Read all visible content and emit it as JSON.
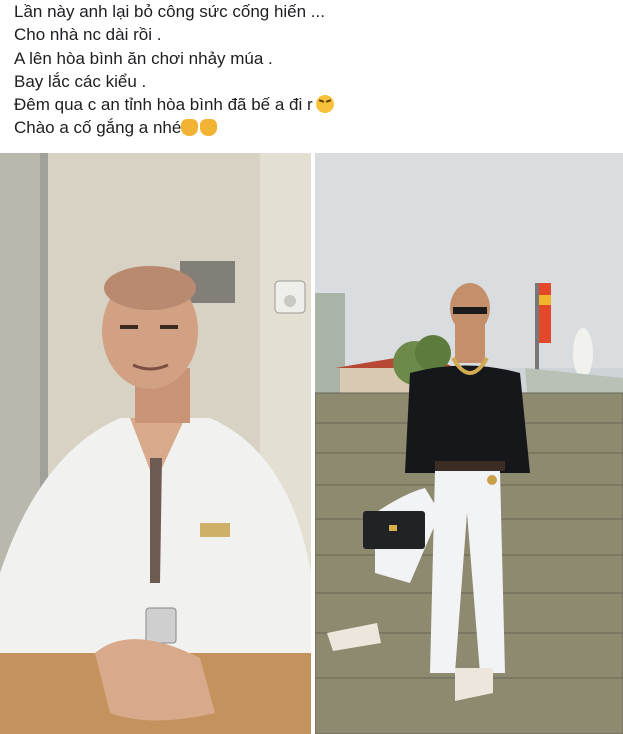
{
  "post": {
    "lines": [
      "Lần này anh lại bỏ công sức cống hiến ...",
      "Cho nhà nc dài rồi .",
      "A lên hòa bình ăn chơi nhảy múa .",
      "Bay lắc các kiểu .",
      "Đêm qua c an tỉnh hòa bình đã bế a đi r",
      "Chào a cố gắng a nhé"
    ],
    "line5_emoji": "tired-face-icon",
    "line6_emoji": [
      "clapping-hands-icon",
      "clapping-hands-icon"
    ]
  },
  "photos": [
    {
      "name": "photo-left",
      "subject": "man in white shirt seated at table"
    },
    {
      "name": "photo-right",
      "subject": "man in black shirt on temple stairs"
    }
  ]
}
